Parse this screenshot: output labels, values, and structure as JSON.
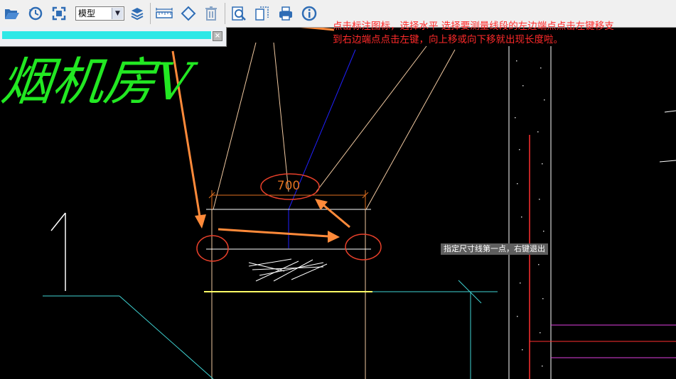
{
  "toolbar": {
    "open_icon": "folder-open-icon",
    "history_icon": "clock-history-icon",
    "fit_icon": "zoom-extents-icon",
    "model_select": {
      "value": "模型",
      "options": [
        "模型"
      ]
    },
    "layers_icon": "layers-icon",
    "dimension_icon": "dimension-ruler-icon",
    "eraser_icon": "eraser-icon",
    "delete_icon": "trash-icon",
    "search_icon": "zoom-search-icon",
    "copy_icon": "copy-icon",
    "print_icon": "printer-icon",
    "info_icon": "info-icon"
  },
  "tab": {
    "close_label": "×"
  },
  "annotation": {
    "line1": "点击标注图标，选择水平 选择要测量线段的左边端点点击左键移支",
    "line2": "到右边端点点击左键，向上移或向下移就出现长度啦。"
  },
  "status_tip": "指定尺寸线第一点，右键退出",
  "drawing": {
    "room_label": "烟机房V",
    "dimension_value": "700"
  },
  "colors": {
    "canvas": "#000000",
    "annotation_text": "#ff2a2a",
    "arrow": "#ff8a3a",
    "room_label": "#22e822",
    "dimension": "#e07020",
    "progress": "#2ee8e6"
  }
}
